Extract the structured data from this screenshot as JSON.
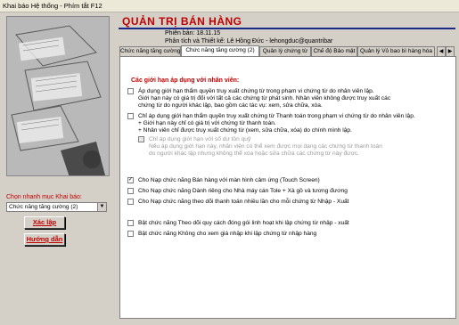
{
  "window": {
    "title": "Khai báo Hệ thống  - Phím tắt F12"
  },
  "header": {
    "app_title": "QUẢN TRỊ BÁN HÀNG",
    "version": "Phiên bản: 18.11.15",
    "author": "Phân tích và Thiết kế: Lê Hồng Đức - lehongduc@quantribar"
  },
  "left": {
    "quick_select_label": "Chọn nhanh mục Khai báo:",
    "quick_select_value": "Chức năng tăng cường (2)",
    "confirm_label": "Xác lập",
    "help_label": "Hướng dẫn"
  },
  "tabs": [
    {
      "label": "Chức năng tăng cường"
    },
    {
      "label": "Chức năng tăng cường (2)"
    },
    {
      "label": "Quản lý chứng từ"
    },
    {
      "label": "Chế độ Bảo mật"
    },
    {
      "label": "Quản lý Vỏ bao bì hàng hóa"
    }
  ],
  "panel": {
    "section_title": "Các giới hạn áp dụng với nhân viên:",
    "opt1": {
      "checked": false,
      "lines": [
        "Áp dụng giới hạn thẩm quyền truy xuất chứng từ trong phạm vi chứng từ do nhân viên lập.",
        "Giới hạn này có giá trị đối với tất cả các chứng từ phát sinh. Nhân viên không được truy xuất các",
        "chứng từ do người khác lập, bao gồm các tác vụ: xem, sửa chữa, xóa."
      ]
    },
    "opt2": {
      "checked": false,
      "lines": [
        "Chỉ áp dụng giới hạn thẩm quyền truy xuất chứng từ Thanh toán trong phạm vi chứng từ do nhân viên lập.",
        "+ Giới hạn này chỉ có giá trị với chứng từ thanh toán.",
        "+ Nhân viên chỉ được truy xuất chứng từ (xem, sửa chữa, xóa) do chính mình lập."
      ]
    },
    "opt3": {
      "checked": false,
      "lines": [
        "Chỉ áp dụng giới hạn với số dư tồn quỹ",
        "Nếu áp dụng giới hạn này, nhân viên có thể xem được mọi dạng các chứng từ thanh toán",
        "do người khác lập nhưng không thể xóa hoặc sửa chữa các chứng từ này được."
      ]
    },
    "opt4": {
      "checked": true,
      "label": "Cho Nạp chức năng Bán hàng với màn hình cảm ứng (Touch Screen)"
    },
    "opt5": {
      "checked": false,
      "label": "Cho Nạp chức năng Dành riêng cho Nhà máy cán Tole + Xà gồ và tương đương"
    },
    "opt6": {
      "checked": false,
      "label": "Cho Nạp chức năng theo dõi thanh toán nhiều lần cho mỗi chứng từ Nhập - Xuất"
    },
    "opt7": {
      "checked": false,
      "label": "Bật chức năng Theo dõi quy cách đóng gói linh hoạt khi lập chứng từ nhập - xuất"
    },
    "opt8": {
      "checked": false,
      "label": "Bật chức năng Không cho xem giá nhập khi lập chứng từ nhập hàng"
    }
  },
  "colors": {
    "accent": "#c00000",
    "title_rule": "#1a2a8a"
  }
}
